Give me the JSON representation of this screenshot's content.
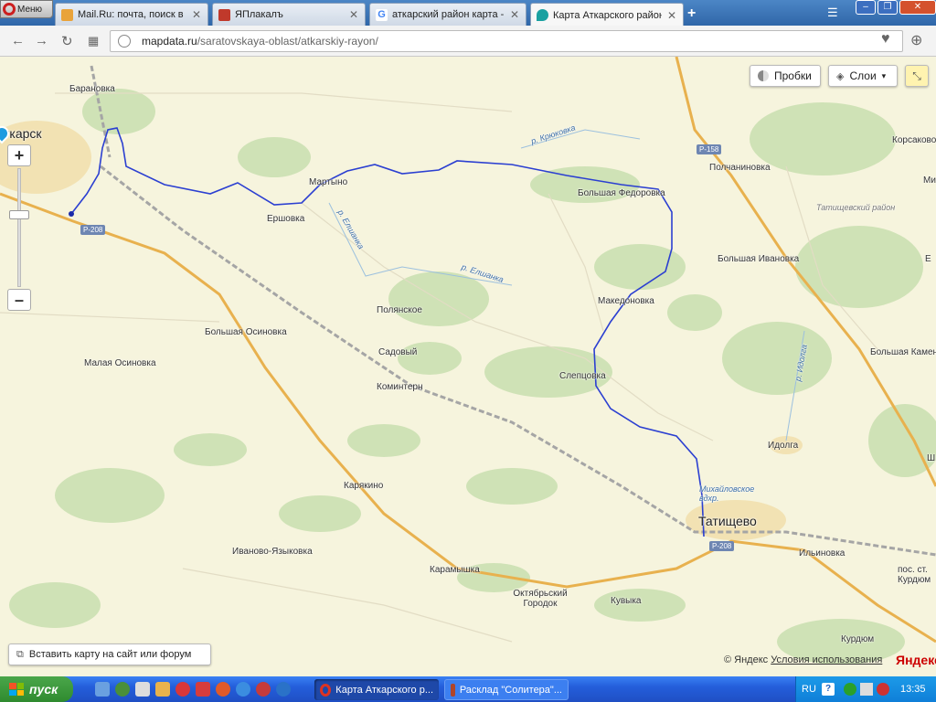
{
  "browser": {
    "menu_label": "Меню",
    "tabs": [
      {
        "label": "Mail.Ru: почта, поиск в инт",
        "icon": "mailru-icon",
        "color": "#e9a33a"
      },
      {
        "label": "ЯПлакалъ",
        "icon": "yaplakal-icon",
        "color": "#c0392b"
      },
      {
        "label": "аткарский район карта - П",
        "icon": "google-icon",
        "color": "#4285f4"
      },
      {
        "label": "Карта Аткарского района С",
        "icon": "map-pin-icon",
        "color": "#1aa1a1"
      }
    ],
    "active_tab": 3,
    "url_host": "mapdata.ru",
    "url_path": "/saratovskaya-oblast/atkarskiy-rayon/"
  },
  "map": {
    "traffic_label": "Пробки",
    "layers_label": "Слои",
    "embed_label": "Вставить карту на сайт или форум",
    "copyright": "© Яндекс",
    "terms": "Условия использования",
    "logo": "Яндекс",
    "labels": {
      "atkarsk": "ткарск",
      "baranovka": "Барановка",
      "martyno": "Мартыно",
      "ershovka": "Ершовка",
      "b_fedorovka": "Большая Федоровка",
      "polchaninovka": "Полчаниновка",
      "korsakovo": "Корсаково",
      "mi": "Ми",
      "tat_rayon": "Татищевский район",
      "b_ivanovka": "Большая Ивановка",
      "polyanskoe": "Полянское",
      "makedonovka": "Македоновка",
      "b_osinovka": "Большая Осиновка",
      "m_osinovka": "Малая Осиновка",
      "sadovy": "Садовый",
      "komintern": "Коминтерн",
      "sleptsovka": "Слепцовка",
      "b_kamen": "Большая Камен",
      "idolga": "Идолга",
      "karyakino": "Карякино",
      "mikh_vdkhr": "Михайловское вдхр.",
      "tatishchevo": "Татищево",
      "ivanovo_yaz": "Иваново-Языковка",
      "karamyshka": "Карамышка",
      "ilinovka": "Ильиновка",
      "oktyabrsky": "Октябрьский Городок",
      "kuvyka": "Кувыка",
      "pos_kurdyum": "пос. ст. Курдюм",
      "kurdyum": "Курдюм",
      "sh": "Ш",
      "e": "Е"
    },
    "rivers": {
      "kryukovka": "р. Крюковка",
      "elshanka1": "р. Елшанка",
      "elshanka2": "р. Елшанка",
      "idolga": "р. Идолга"
    },
    "roads": {
      "r208a": "Р-208",
      "r208b": "Р-208",
      "r158": "Р-158"
    }
  },
  "taskbar": {
    "start_label": "пуск",
    "tasks": [
      {
        "label": "Карта Аткарского р...",
        "icon": "opera-icon"
      },
      {
        "label": "Расклад \"Солитера\"...",
        "icon": "solitaire-icon"
      }
    ],
    "lang": "RU",
    "time": "13:35"
  }
}
